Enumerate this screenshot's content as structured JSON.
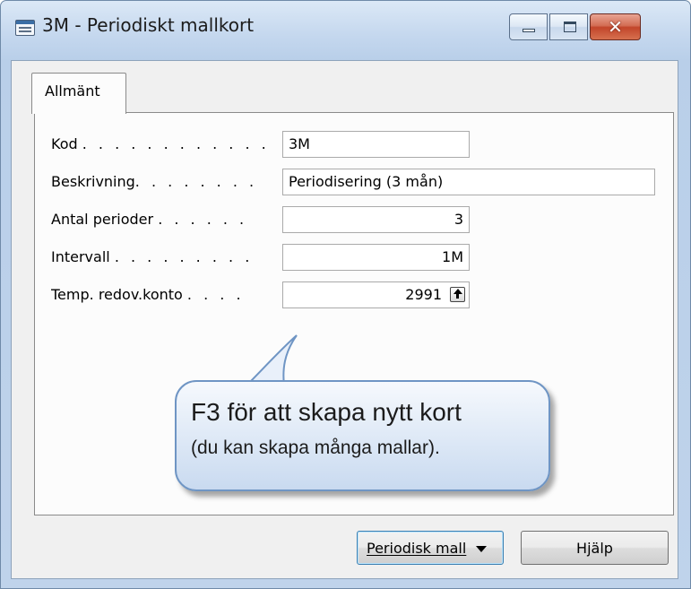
{
  "window": {
    "title": "3M - Periodiskt mallkort",
    "close_glyph": "✕"
  },
  "tabs": [
    {
      "label": "Allmänt",
      "active": true
    }
  ],
  "fields": {
    "kod": {
      "label": "Kod",
      "dots": ". . . . . . . . . . . .",
      "value": "3M"
    },
    "beskrivning": {
      "label": "Beskrivning",
      "dots": ". . . . . . . .",
      "value": "Periodisering (3 mån)"
    },
    "antal_perioder": {
      "label": "Antal perioder",
      "dots": ". . . . . .",
      "value": "3"
    },
    "intervall": {
      "label": "Intervall",
      "dots": ". . . . . . . . .",
      "value": "1M"
    },
    "temp_konto": {
      "label": "Temp. redov.konto",
      "dots": ". . . .",
      "value": "2991"
    }
  },
  "callout": {
    "line1": "F3 för att skapa nytt kort",
    "line2": "(du kan skapa många mallar)."
  },
  "buttons": {
    "periodisk_mall": "Periodisk mall",
    "hjalp": "Hjälp"
  },
  "icons": {
    "app": "form-window-icon",
    "minimize": "minimize-icon",
    "maximize": "maximize-icon",
    "close": "close-icon",
    "lookup": "lookup-arrow-icon",
    "dropdown": "chevron-down-icon"
  },
  "colors": {
    "window_frame": "#b9cfe9",
    "close_button": "#c2452a",
    "callout_border": "#6f95c4"
  }
}
